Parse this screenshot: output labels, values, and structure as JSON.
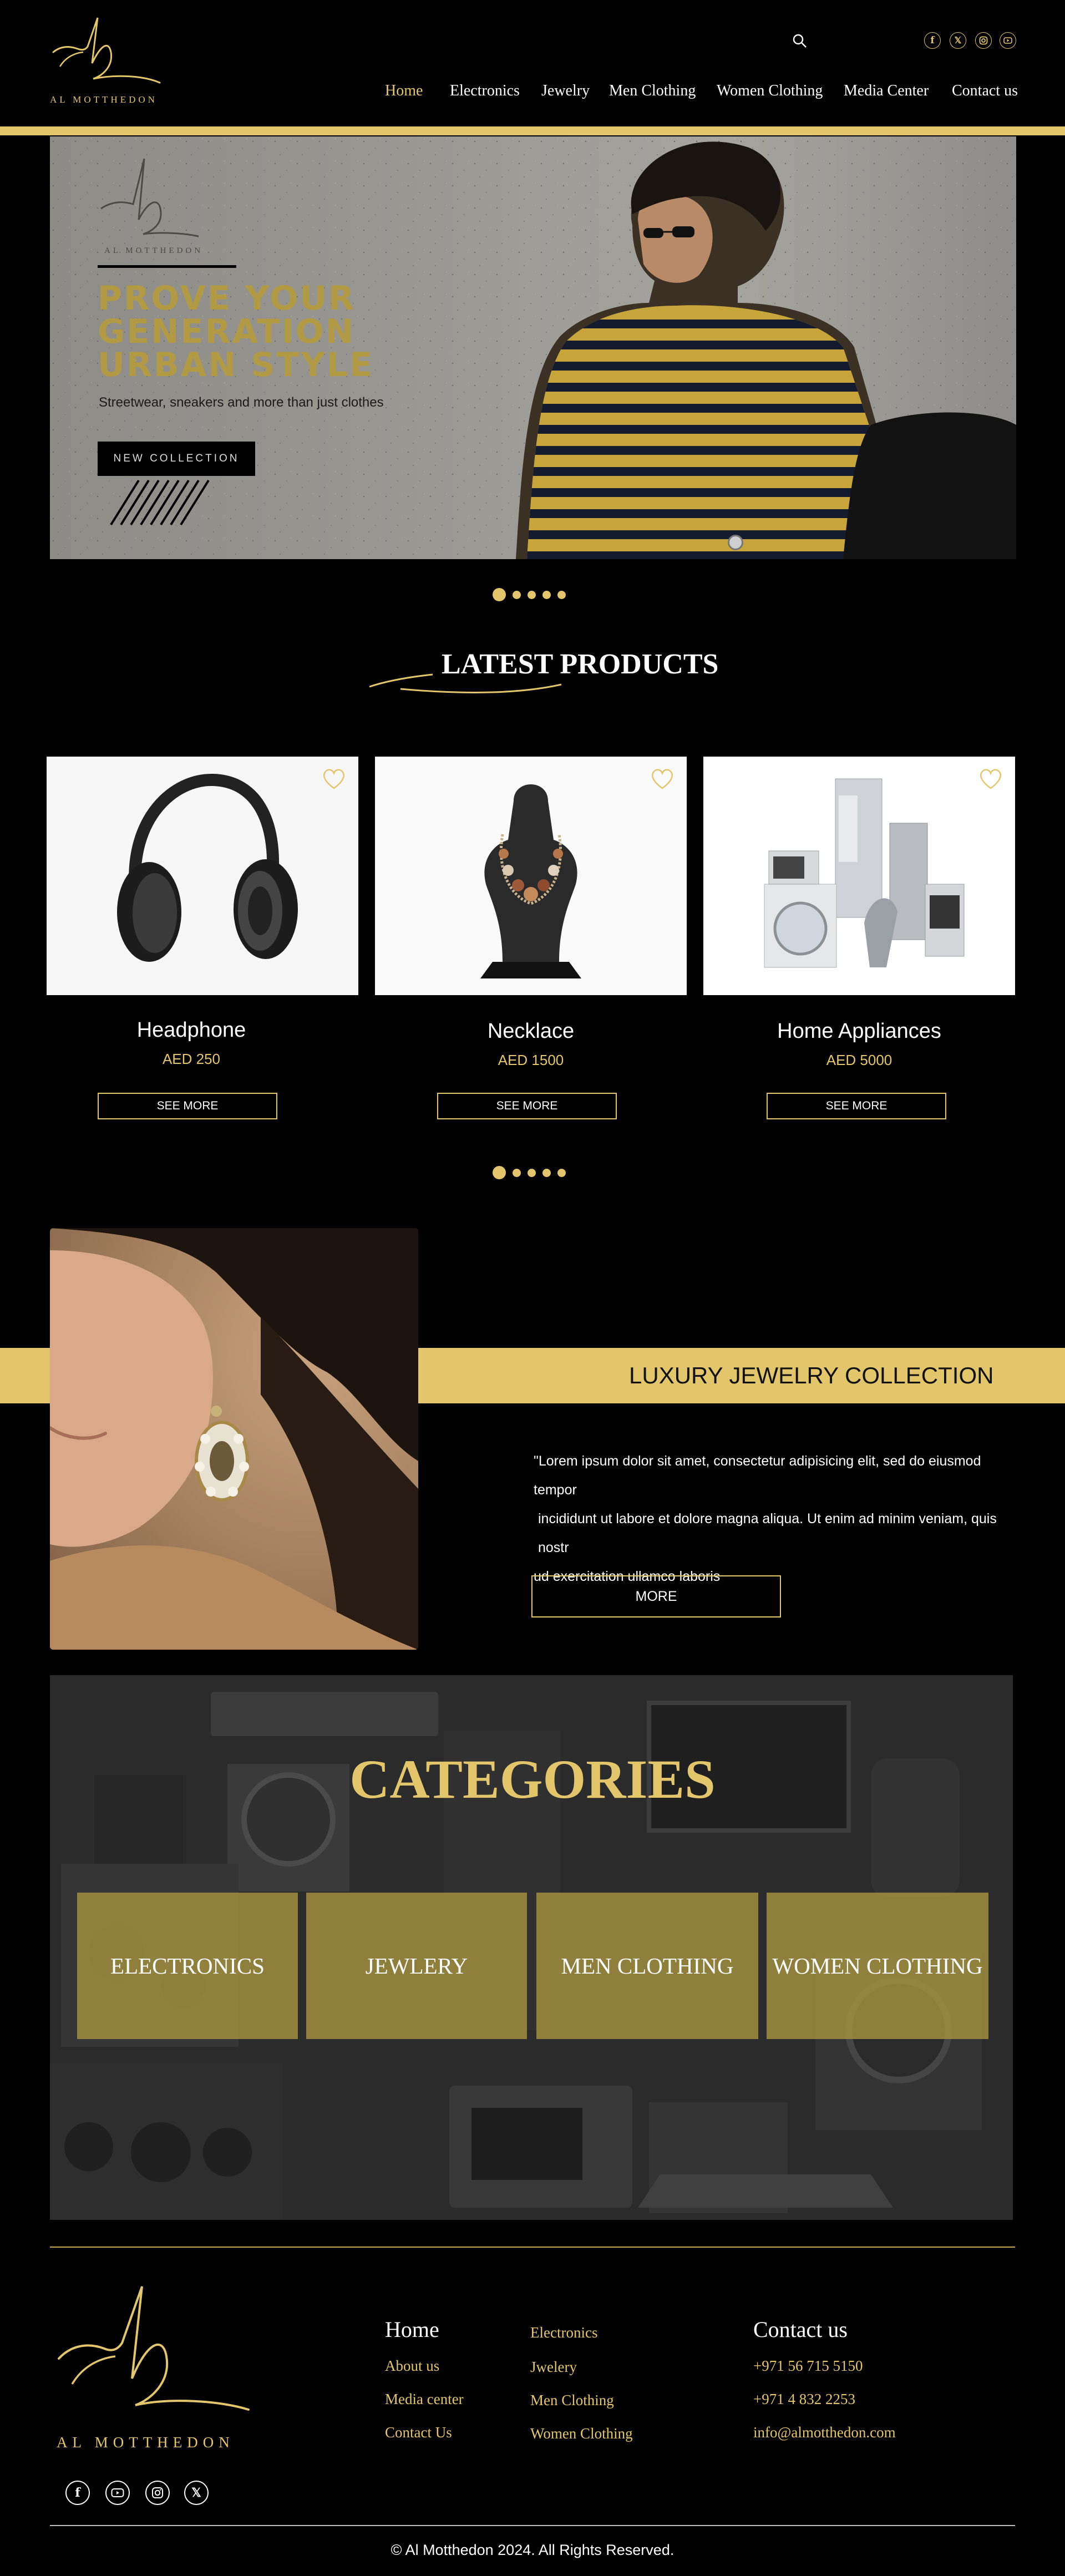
{
  "brand": {
    "name": "AL MOTTHEDON"
  },
  "nav": {
    "items": [
      {
        "label": "Home",
        "active": true
      },
      {
        "label": "Electronics"
      },
      {
        "label": "Jewelry"
      },
      {
        "label": "Men Clothing"
      },
      {
        "label": "Women Clothing"
      },
      {
        "label": "Media Center"
      },
      {
        "label": "Contact us"
      }
    ],
    "search_icon": "search-icon",
    "social_icons": [
      "facebook-icon",
      "x-icon",
      "instagram-icon",
      "youtube-icon"
    ]
  },
  "hero": {
    "logo_text": "AL MOTTHEDON",
    "title_lines": [
      "PROVE YOUR",
      "GENERATION",
      "URBAN STYLE"
    ],
    "subtitle": "Streetwear, sneakers and more than just clothes",
    "button": "NEW COLLECTION",
    "slides_count": 5,
    "active_slide": 1
  },
  "latest": {
    "title": "LATEST PRODUCTS",
    "products": [
      {
        "name": "Headphone",
        "price": "AED 250",
        "button": "SEE MORE",
        "image": "headphone-image"
      },
      {
        "name": "Necklace",
        "price": "AED 1500",
        "button": "SEE MORE",
        "image": "necklace-image"
      },
      {
        "name": "Home Appliances",
        "price": "AED 5000",
        "button": "SEE MORE",
        "image": "home-appliances-image"
      }
    ],
    "slides_count": 5,
    "active_slide": 1
  },
  "luxury": {
    "title": "LUXURY JEWELRY COLLECTION",
    "text_lines": [
      "\"Lorem ipsum dolor sit amet, consectetur adipisicing elit, sed do eiusmod tempor",
      "incididunt ut labore et dolore magna aliqua. Ut enim ad minim veniam, quis nostr",
      "ud exercitation ullamco laboris"
    ],
    "button": "MORE"
  },
  "categories": {
    "title": "CATEGORIES",
    "items": [
      "ELECTRONICS",
      "JEWLERY",
      "MEN CLOTHING",
      "WOMEN CLOTHING"
    ]
  },
  "footer": {
    "logo_text": "AL MOTTHEDON",
    "col1": {
      "heading": "Home",
      "links": [
        "About us",
        "Media center",
        "Contact Us"
      ]
    },
    "col2": {
      "links": [
        "Electronics",
        "Jwelery",
        "Men Clothing",
        "Women Clothing"
      ]
    },
    "contact": {
      "heading": "Contact us",
      "lines": [
        "+971 56 715 5150",
        "+971 4 832 2253",
        "info@almotthedon.com"
      ]
    },
    "social_icons": [
      "facebook-icon",
      "youtube-icon",
      "instagram-icon",
      "x-icon"
    ],
    "copyright": "© Al Motthedon 2024. All Rights Reserved."
  },
  "colors": {
    "gold": "#e3c66b",
    "background": "#000000",
    "tile": "#a69342"
  }
}
